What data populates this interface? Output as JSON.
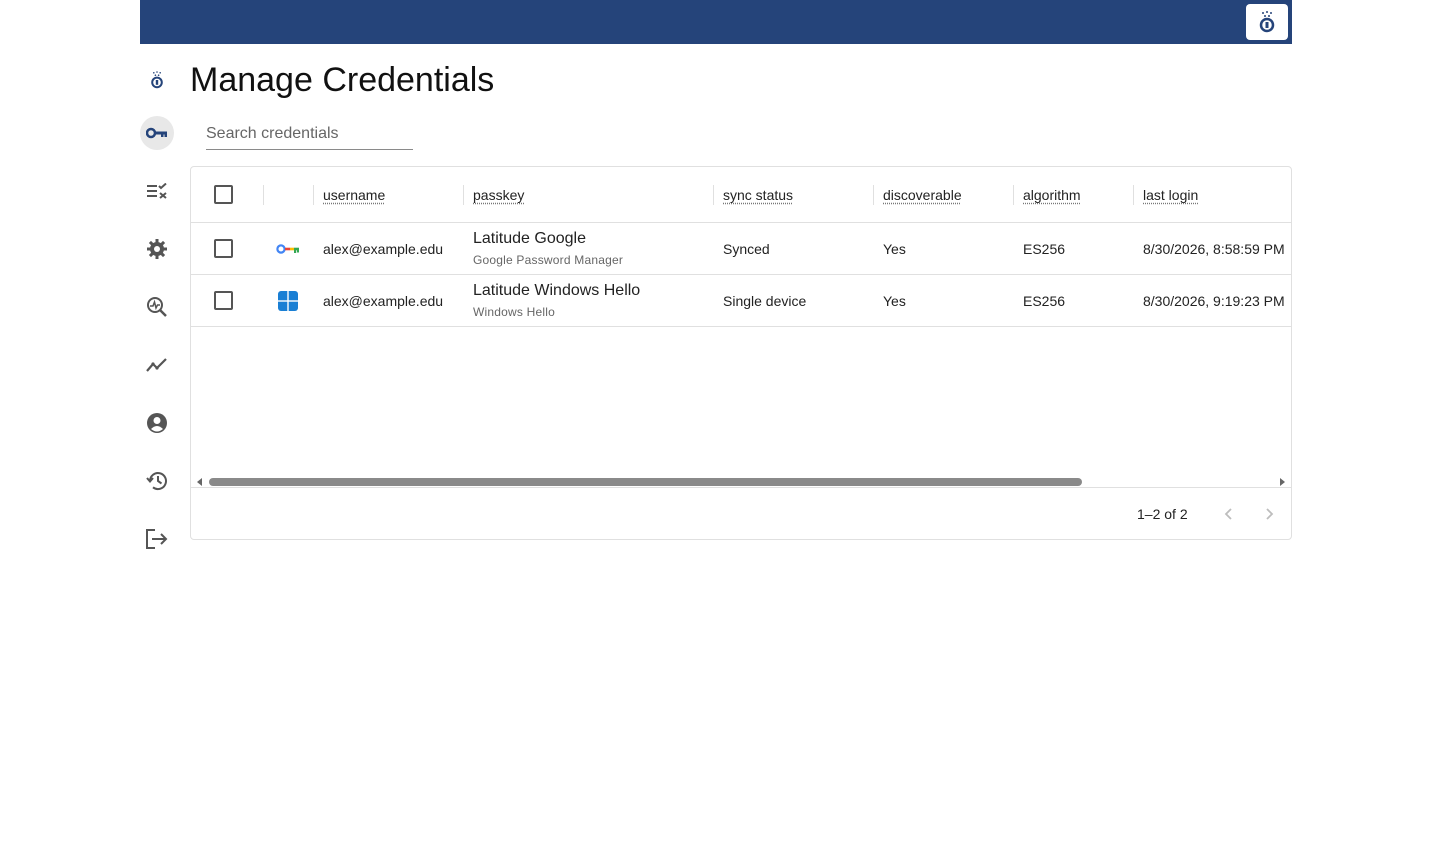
{
  "page": {
    "title": "Manage Credentials"
  },
  "search": {
    "placeholder": "Search credentials",
    "value": ""
  },
  "sidebar": {
    "items": [
      {
        "icon": "logo-icon",
        "active": false
      },
      {
        "icon": "key-icon",
        "active": true
      },
      {
        "icon": "checklist-icon",
        "active": false
      },
      {
        "icon": "gear-icon",
        "active": false
      },
      {
        "icon": "search-activity-icon",
        "active": false
      },
      {
        "icon": "trending-icon",
        "active": false
      },
      {
        "icon": "account-icon",
        "active": false
      },
      {
        "icon": "history-icon",
        "active": false
      },
      {
        "icon": "logout-icon",
        "active": false
      }
    ]
  },
  "table": {
    "columns": [
      "username",
      "passkey",
      "sync status",
      "discoverable",
      "algorithm",
      "last login"
    ],
    "rows": [
      {
        "provider_icon": "google-password-manager-icon",
        "username": "alex@example.edu",
        "passkey_name": "Latitude Google",
        "provider": "Google Password Manager",
        "sync_status": "Synced",
        "discoverable": "Yes",
        "algorithm": "ES256",
        "last_login": "8/30/2026, 8:58:59 PM"
      },
      {
        "provider_icon": "windows-hello-icon",
        "username": "alex@example.edu",
        "passkey_name": "Latitude Windows Hello",
        "provider": "Windows Hello",
        "sync_status": "Single device",
        "discoverable": "Yes",
        "algorithm": "ES256",
        "last_login": "8/30/2026, 9:19:23 PM"
      }
    ]
  },
  "pagination": {
    "range_label": "1–2 of 2"
  },
  "colors": {
    "header_bar": "#25447a",
    "accent": "#25447a"
  }
}
